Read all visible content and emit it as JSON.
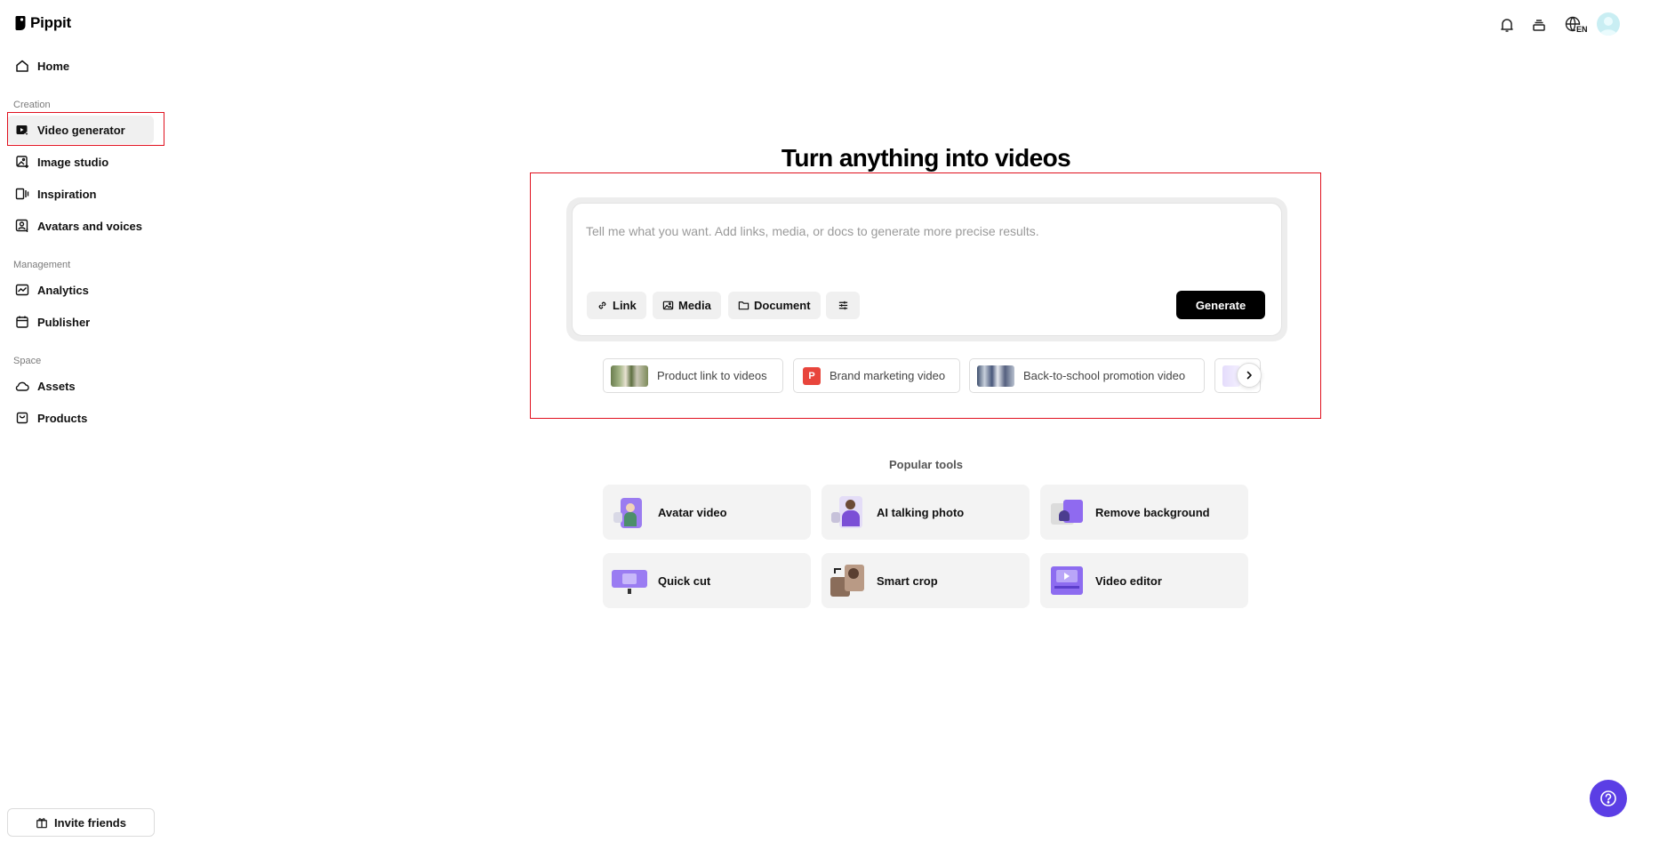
{
  "brand": {
    "name": "Pippit"
  },
  "sidebar": {
    "home": "Home",
    "sections": {
      "creation": "Creation",
      "management": "Management",
      "space": "Space"
    },
    "items": [
      {
        "key": "video-generator",
        "label": "Video generator",
        "active": true
      },
      {
        "key": "image-studio",
        "label": "Image studio"
      },
      {
        "key": "inspiration",
        "label": "Inspiration"
      },
      {
        "key": "avatars-voices",
        "label": "Avatars and voices"
      },
      {
        "key": "analytics",
        "label": "Analytics"
      },
      {
        "key": "publisher",
        "label": "Publisher"
      },
      {
        "key": "assets",
        "label": "Assets"
      },
      {
        "key": "products",
        "label": "Products"
      }
    ],
    "invite": "Invite friends"
  },
  "topbar": {
    "language": "EN",
    "icons": [
      "bell-icon",
      "stack-icon",
      "globe-icon",
      "avatar"
    ]
  },
  "main": {
    "title": "Turn anything into videos",
    "prompt": {
      "placeholder": "Tell me what you want. Add links, media, or docs to generate more precise results.",
      "value": ""
    },
    "chips": {
      "link": "Link",
      "media": "Media",
      "document": "Document"
    },
    "generate": "Generate",
    "suggestions": [
      "Product link to videos",
      "Brand marketing video",
      "Back-to-school promotion video"
    ],
    "brand_badge": "P",
    "popular_title": "Popular tools",
    "tools": [
      "Avatar video",
      "AI talking photo",
      "Remove background",
      "Quick cut",
      "Smart crop",
      "Video editor"
    ]
  },
  "colors": {
    "accent": "#5b3ee5",
    "highlight": "#e0101e",
    "primary_button": "#000000",
    "brand_badge": "#e8453c"
  }
}
